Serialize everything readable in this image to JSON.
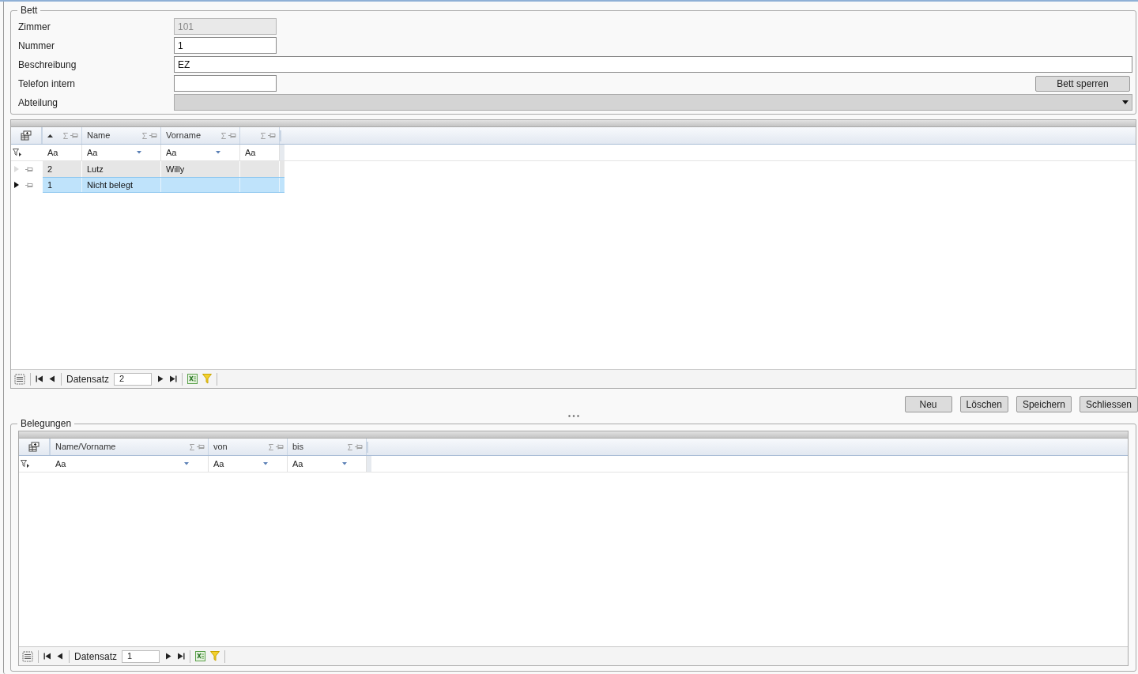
{
  "bett": {
    "title": "Bett",
    "fields": [
      {
        "label": "Zimmer",
        "value": "101",
        "kind": "short",
        "disabled": true
      },
      {
        "label": "Nummer",
        "value": "1",
        "kind": "short",
        "disabled": false
      },
      {
        "label": "Beschreibung",
        "value": "EZ",
        "kind": "wide",
        "disabled": false
      },
      {
        "label": "Telefon intern",
        "kind": "short",
        "disabled": false
      },
      {
        "label": "Abteilung",
        "kind": "select",
        "disabled": true
      }
    ],
    "lock_button": "Bett sperren"
  },
  "beds_grid": {
    "columns": [
      {
        "sorted_ascending": true,
        "filter": "Aa",
        "dropdown": false
      },
      {
        "header": "Name",
        "filter": "Aa",
        "dropdown": true
      },
      {
        "header": "Vorname",
        "filter": "Aa",
        "dropdown": true
      },
      {
        "filter": "Aa",
        "dropdown": false
      }
    ],
    "rows": [
      {
        "cells": [
          "2",
          "Lutz",
          "Willy",
          null
        ],
        "selected": false
      },
      {
        "cells": [
          "1",
          "Nicht belegt",
          null,
          null
        ],
        "selected": true
      }
    ],
    "navigator": {
      "label": "Datensatz",
      "value": "2"
    }
  },
  "buttons": [
    "Neu",
    "Löschen",
    "Speichern",
    "Schliessen"
  ],
  "belegungen": {
    "title": "Belegungen",
    "columns": [
      {
        "header": "Name/Vorname",
        "filter": "Aa",
        "dropdown": true
      },
      {
        "header": "von",
        "filter": "Aa",
        "dropdown": true
      },
      {
        "header": "bis",
        "filter": "Aa",
        "dropdown": true
      }
    ],
    "navigator": {
      "label": "Datensatz",
      "value": "1"
    }
  }
}
